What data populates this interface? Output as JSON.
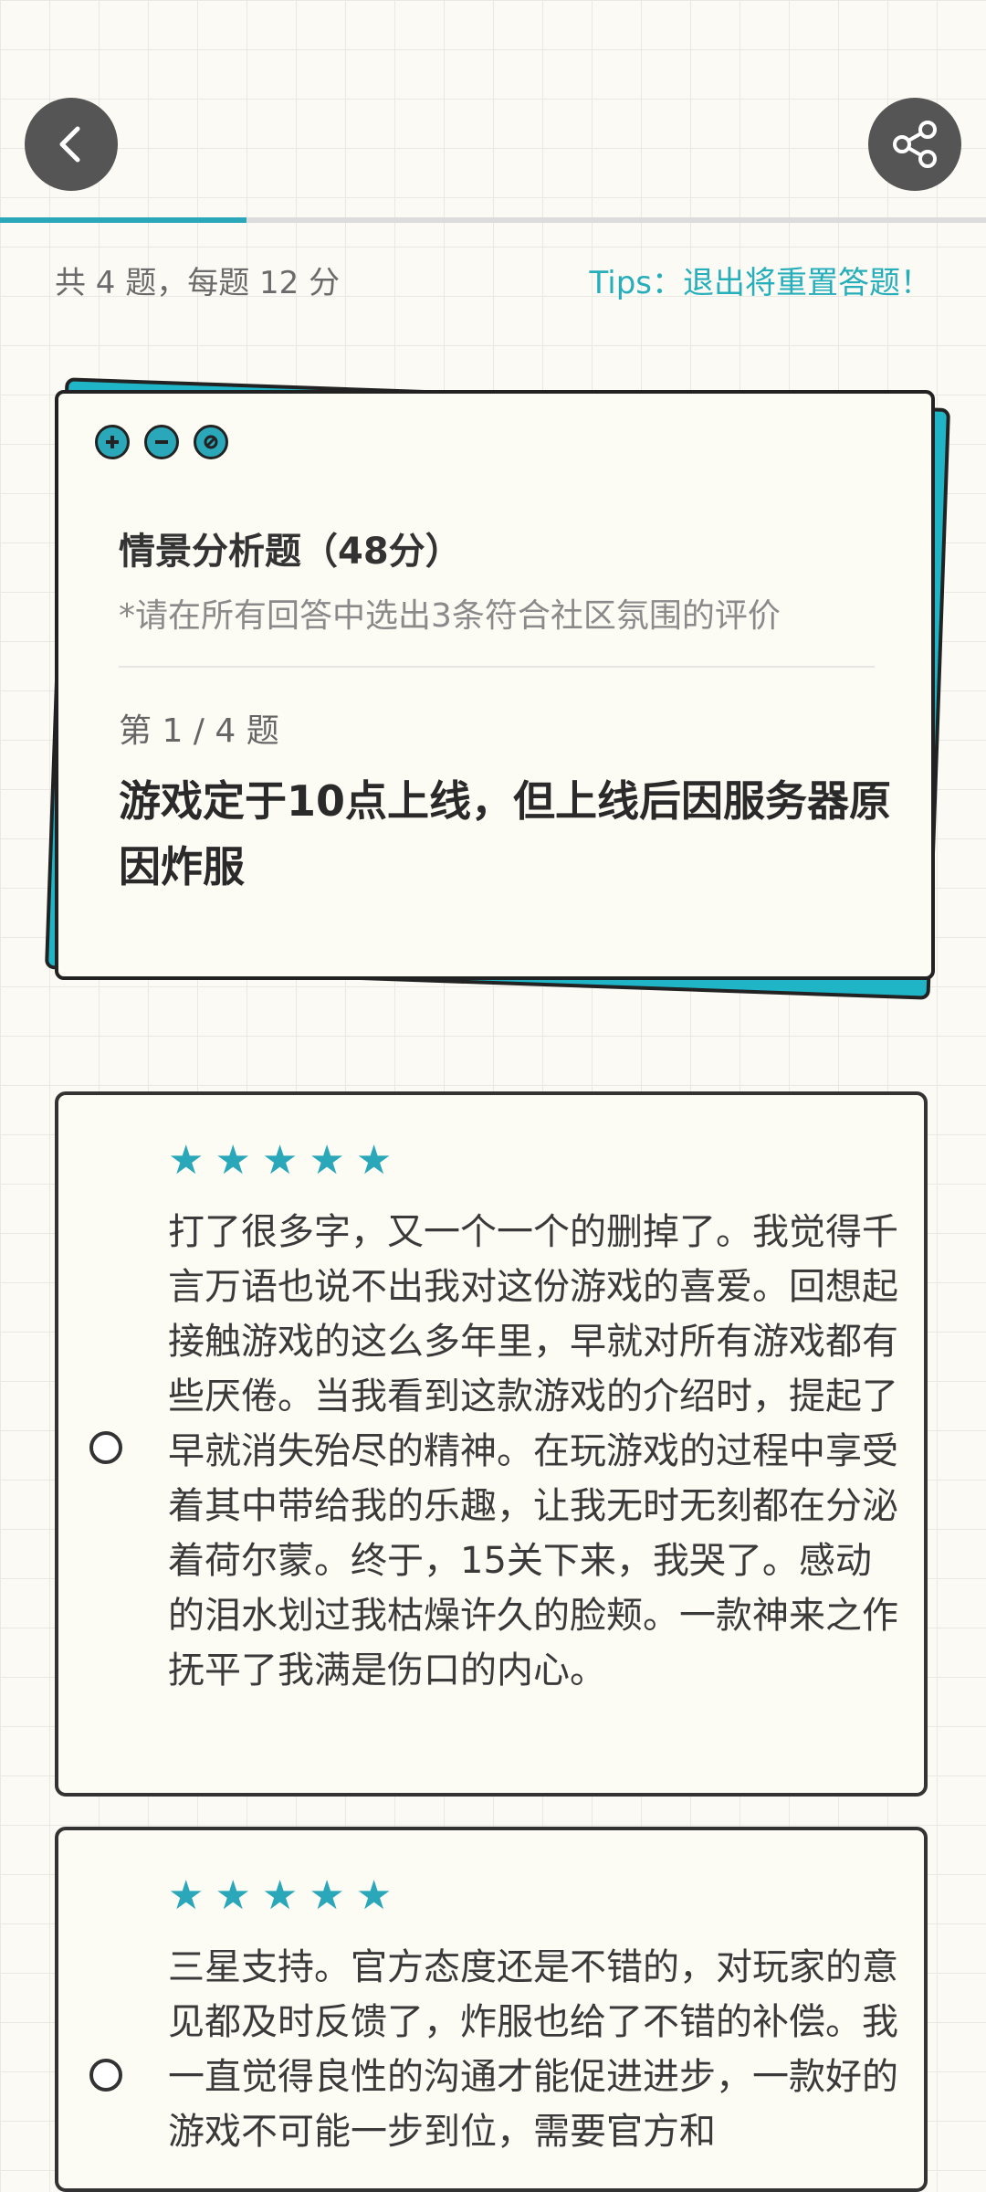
{
  "status_bar": {
    "left": "",
    "right": ""
  },
  "header": {
    "back_icon": "chevron-left-icon",
    "share_icon": "share-icon",
    "progress": 0.25
  },
  "meta": {
    "total": "共 4 题，每题 12 分",
    "tips": "Tips：退出将重置答题！"
  },
  "question_card": {
    "heading": "情景分析题（48分）",
    "note": "*请在所有回答中选出3条符合社区氛围的评价",
    "counter": "第 1 / 4 题",
    "text": "游戏定于10点上线，但上线后因服务器原因炸服",
    "window_icons": [
      "plus-icon",
      "minus-icon",
      "cancel-icon"
    ]
  },
  "answers": [
    {
      "stars": 5,
      "text": "打了很多字，又一个一个的删掉了。我觉得千言万语也说不出我对这份游戏的喜爱。回想起接触游戏的这么多年里，早就对所有游戏都有些厌倦。当我看到这款游戏的介绍时，提起了早就消失殆尽的精神。在玩游戏的过程中享受着其中带给我的乐趣，让我无时无刻都在分泌着荷尔蒙。终于，15关下来，我哭了。感动的泪水划过我枯燥许久的脸颊。一款神来之作抚平了我满是伤口的内心。"
    },
    {
      "stars": 5,
      "text": "三星支持。官方态度还是不错的，对玩家的意见都及时反馈了，炸服也给了不错的补偿。我一直觉得良性的沟通才能促进进步，一款好的游戏不可能一步到位，需要官方和"
    }
  ],
  "colors": {
    "accent": "#2aa8b9",
    "card_back": "#1fb4c6",
    "tips": "#27aebb"
  }
}
